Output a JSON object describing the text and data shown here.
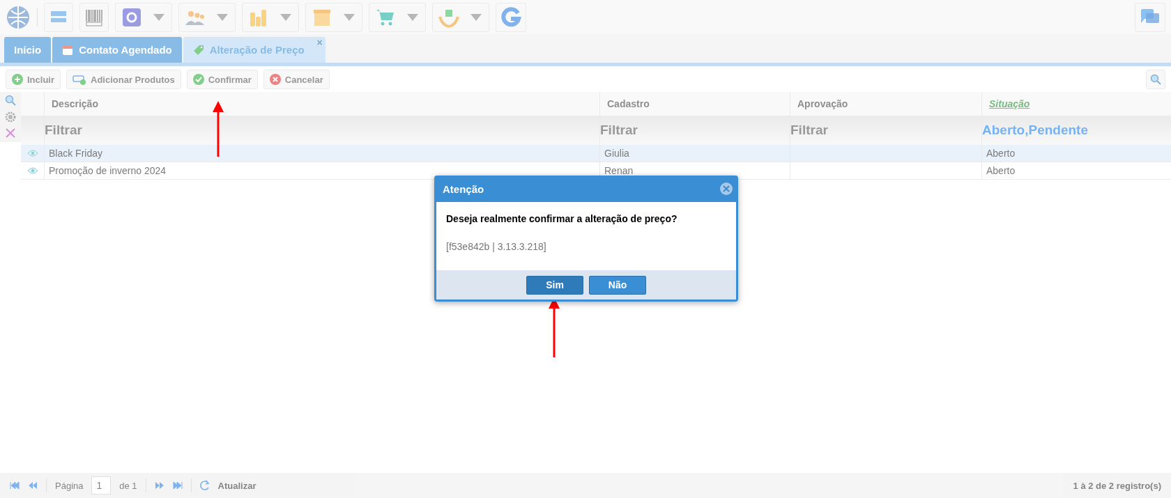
{
  "tabs": [
    {
      "label": "Início",
      "selected": false,
      "kind": "home"
    },
    {
      "label": "Contato Agendado",
      "selected": false,
      "kind": "calendar"
    },
    {
      "label": "Alteração de Preço",
      "selected": true,
      "kind": "tag",
      "close": "×"
    }
  ],
  "actions": [
    {
      "label": "Incluir",
      "kind": "add"
    },
    {
      "label": "Adicionar Produtos",
      "kind": "products"
    },
    {
      "label": "Confirmar",
      "kind": "confirm"
    },
    {
      "label": "Cancelar",
      "kind": "cancel"
    }
  ],
  "table": {
    "columns": [
      {
        "label": "Descrição",
        "sorted": false
      },
      {
        "label": "Cadastro",
        "sorted": false
      },
      {
        "label": "Aprovação",
        "sorted": false
      },
      {
        "label": "Situação",
        "sorted": true
      }
    ],
    "filters": [
      {
        "text": "Filtrar",
        "active": false
      },
      {
        "text": "Filtrar",
        "active": false
      },
      {
        "text": "Filtrar",
        "active": false
      },
      {
        "text": "Aberto,Pendente",
        "active": true
      }
    ],
    "rows": [
      {
        "selected": true,
        "descricao": "Black Friday",
        "cadastro": "Giulia",
        "situacao": "Aberto"
      },
      {
        "selected": false,
        "descricao": "Promoção de inverno 2024",
        "cadastro": "Renan",
        "situacao": "Aberto"
      }
    ]
  },
  "pager": {
    "page_label": "Página",
    "page": "1",
    "of": "de 1",
    "refresh": "Atualizar",
    "summary": "1 à 2 de 2 registro(s)"
  },
  "dialog": {
    "title": "Atenção",
    "message": "Deseja realmente confirmar a alteração de preço?",
    "detail": "[f53e842b | 3.13.3.218]",
    "buttons": [
      {
        "label": "Sim",
        "selected": true
      },
      {
        "label": "Não",
        "selected": false
      }
    ]
  }
}
